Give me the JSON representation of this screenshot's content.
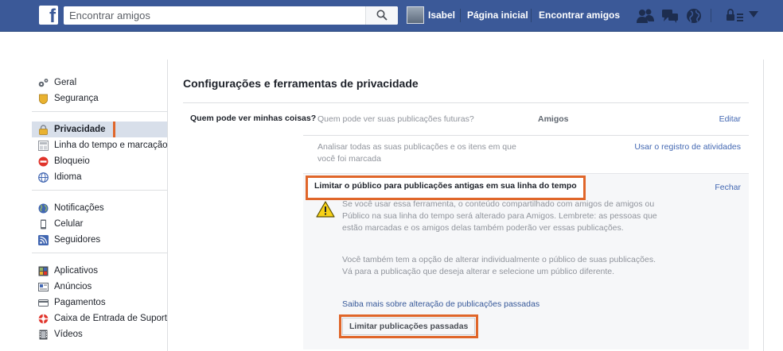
{
  "topbar": {
    "logo": "f",
    "search_placeholder": "Encontrar amigos",
    "user_name": "Isabel",
    "home_link": "Página inicial",
    "find_friends_link": "Encontrar amigos",
    "bg_color": "#3b5998",
    "icons": [
      "friend-requests-icon",
      "messages-icon",
      "notifications-globe-icon",
      "privacy-shortcuts-lock-icon",
      "account-chevron-icon"
    ]
  },
  "sidebar": {
    "groups": [
      [
        {
          "label": "Geral",
          "icon": "gear-icon"
        },
        {
          "label": "Segurança",
          "icon": "shield-badge-icon"
        }
      ],
      [
        {
          "label": "Privacidade",
          "icon": "lock-icon",
          "active": true
        },
        {
          "label": "Linha do tempo e marcação",
          "icon": "timeline-icon"
        },
        {
          "label": "Bloqueio",
          "icon": "block-icon"
        },
        {
          "label": "Idioma",
          "icon": "language-globe-icon"
        }
      ],
      [
        {
          "label": "Notificações",
          "icon": "globe-icon"
        },
        {
          "label": "Celular",
          "icon": "mobile-icon"
        },
        {
          "label": "Seguidores",
          "icon": "rss-icon"
        }
      ],
      [
        {
          "label": "Aplicativos",
          "icon": "apps-icon"
        },
        {
          "label": "Anúncios",
          "icon": "ads-icon"
        },
        {
          "label": "Pagamentos",
          "icon": "card-icon"
        },
        {
          "label": "Caixa de Entrada de Suporte",
          "icon": "lifebuoy-icon"
        },
        {
          "label": "Vídeos",
          "icon": "film-icon"
        }
      ]
    ]
  },
  "main": {
    "title": "Configurações e ferramentas de privacidade",
    "section_label": "Quem pode ver minhas coisas?",
    "rows": [
      {
        "question": "Quem pode ver suas publicações futuras?",
        "value": "Amigos",
        "action": "Editar"
      },
      {
        "question": "Analisar todas as suas publicações e os itens em que você foi marcada",
        "value": "",
        "action": "Usar o registro de atividades"
      }
    ],
    "expanded": {
      "title": "Limitar o público para publicações antigas em sua linha do tempo",
      "close": "Fechar",
      "warning": "Se você usar essa ferramenta, o conteúdo compartilhado com amigos de amigos ou Público na sua linha do tempo será alterado para Amigos. Lembrete: as pessoas que estão marcadas e os amigos delas também poderão ver essas publicações.",
      "info": "Você também tem a opção de alterar individualmente o público de suas publicações. Vá para a publicação que deseja alterar e selecione um público diferente.",
      "learn_more": "Saiba mais sobre alteração de publicações passadas",
      "button": "Limitar publicações passadas"
    }
  },
  "highlight_color": "#e0662a"
}
